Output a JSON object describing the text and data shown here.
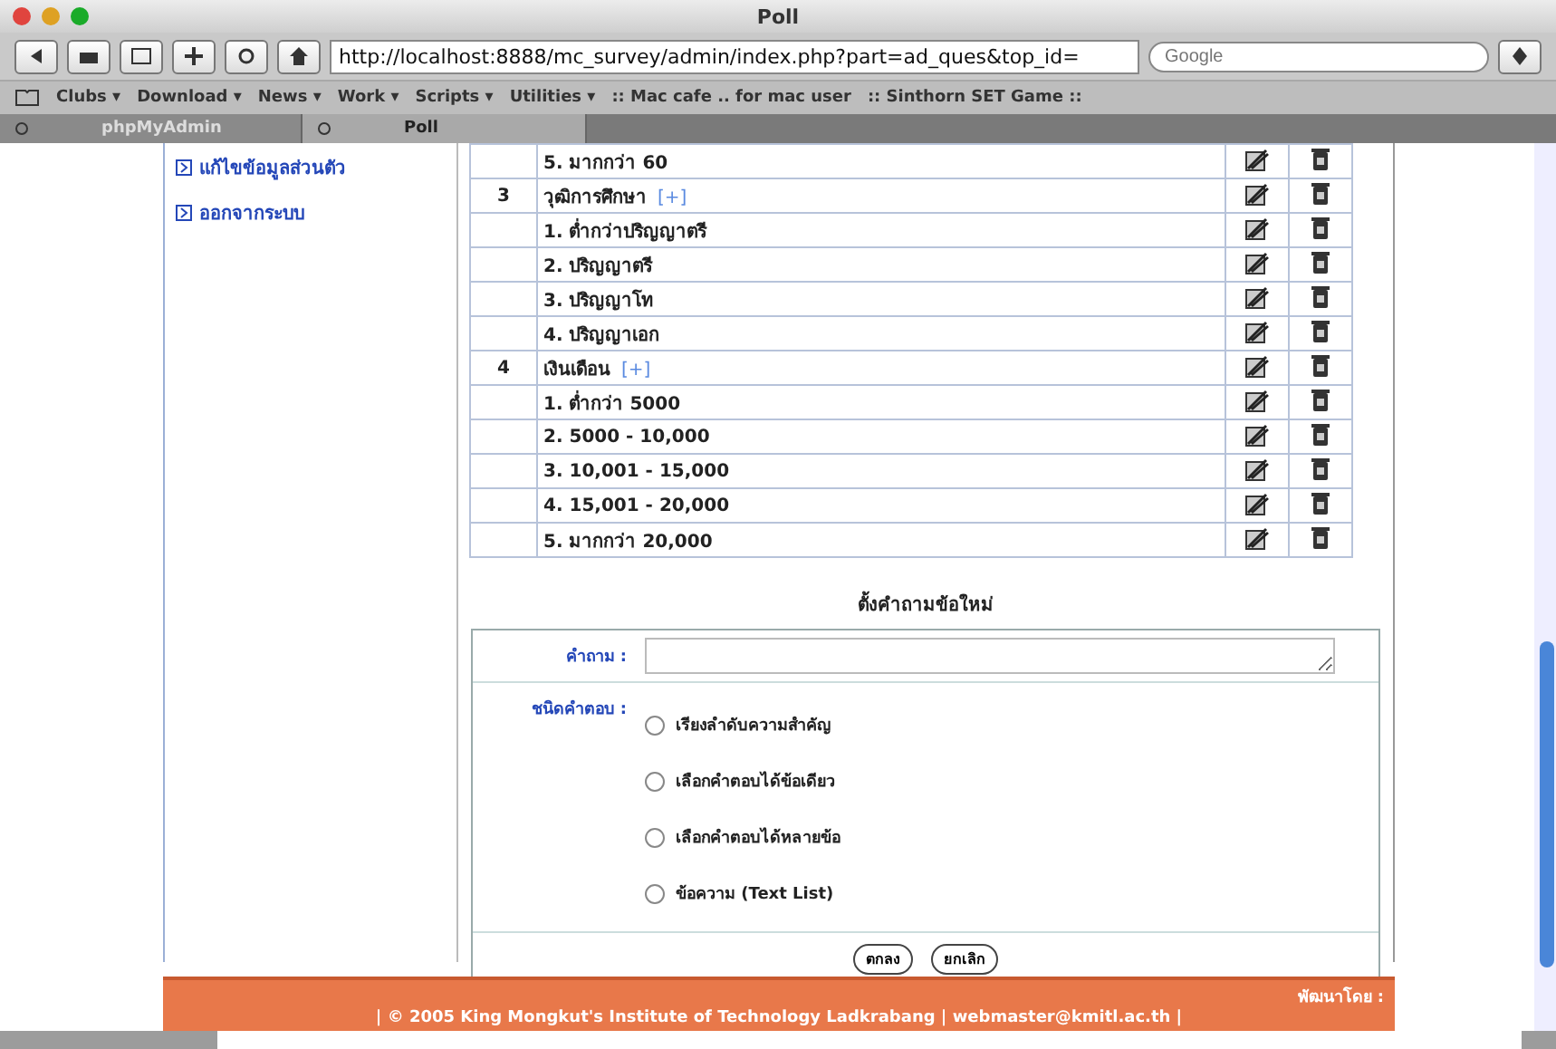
{
  "window": {
    "title": "Poll"
  },
  "toolbar": {
    "url": "http://localhost:8888/mc_survey/admin/index.php?part=ad_ques&top_id=",
    "search": {
      "placeholder": "Google"
    }
  },
  "bookmarks": [
    {
      "label": "Clubs ▾"
    },
    {
      "label": "Download ▾"
    },
    {
      "label": "News ▾"
    },
    {
      "label": "Work ▾"
    },
    {
      "label": "Scripts ▾"
    },
    {
      "label": "Utilities ▾"
    },
    {
      "label": ":: Mac cafe .. for mac user"
    },
    {
      "label": ":: Sinthorn SET Game ::"
    }
  ],
  "tabs": [
    {
      "label": "phpMyAdmin",
      "selected": false
    },
    {
      "label": "Poll",
      "selected": true
    }
  ],
  "sidebar": {
    "items": [
      {
        "label": "แก้ไขข้อมูลส่วนตัว"
      },
      {
        "label": "ออกจากระบบ"
      }
    ]
  },
  "table": {
    "rows": [
      {
        "kind": "option",
        "text": "5. มากกว่า 60"
      },
      {
        "kind": "question",
        "number": "3",
        "text": "วุฒิการศึกษา",
        "add": "[+]"
      },
      {
        "kind": "option",
        "text": "1. ต่ำกว่าปริญญาตรี"
      },
      {
        "kind": "option",
        "text": "2. ปริญญาตรี"
      },
      {
        "kind": "option",
        "text": "3. ปริญญาโท"
      },
      {
        "kind": "option",
        "text": "4. ปริญญาเอก"
      },
      {
        "kind": "question",
        "number": "4",
        "text": "เงินเดือน",
        "add": "[+]"
      },
      {
        "kind": "option",
        "text": "1. ต่ำกว่า 5000"
      },
      {
        "kind": "option",
        "text": "2. 5000 - 10,000"
      },
      {
        "kind": "option",
        "text": "3. 10,001 - 15,000"
      },
      {
        "kind": "option",
        "text": "4. 15,001 - 20,000"
      },
      {
        "kind": "option",
        "text": "5. มากกว่า 20,000"
      }
    ]
  },
  "form": {
    "title": "ตั้งคำถามข้อใหม่",
    "question_label": "คำถาม :",
    "type_label": "ชนิดคำตอบ :",
    "options": [
      {
        "label": "เรียงลำดับความสำคัญ",
        "selected": false
      },
      {
        "label": "เลือกคำตอบได้ข้อเดียว",
        "selected": false
      },
      {
        "label": "เลือกคำตอบได้หลายข้อ",
        "selected": false
      },
      {
        "label": "ข้อความ (Text List)",
        "selected": false
      }
    ],
    "buttons": [
      "ตกลง",
      "ยกเลิก"
    ]
  },
  "footer": {
    "developer": "พัฒนาโดย :",
    "copyright": "| © 2005 King Mongkut's Institute of Technology Ladkrabang | webmaster@kmitl.ac.th |"
  }
}
